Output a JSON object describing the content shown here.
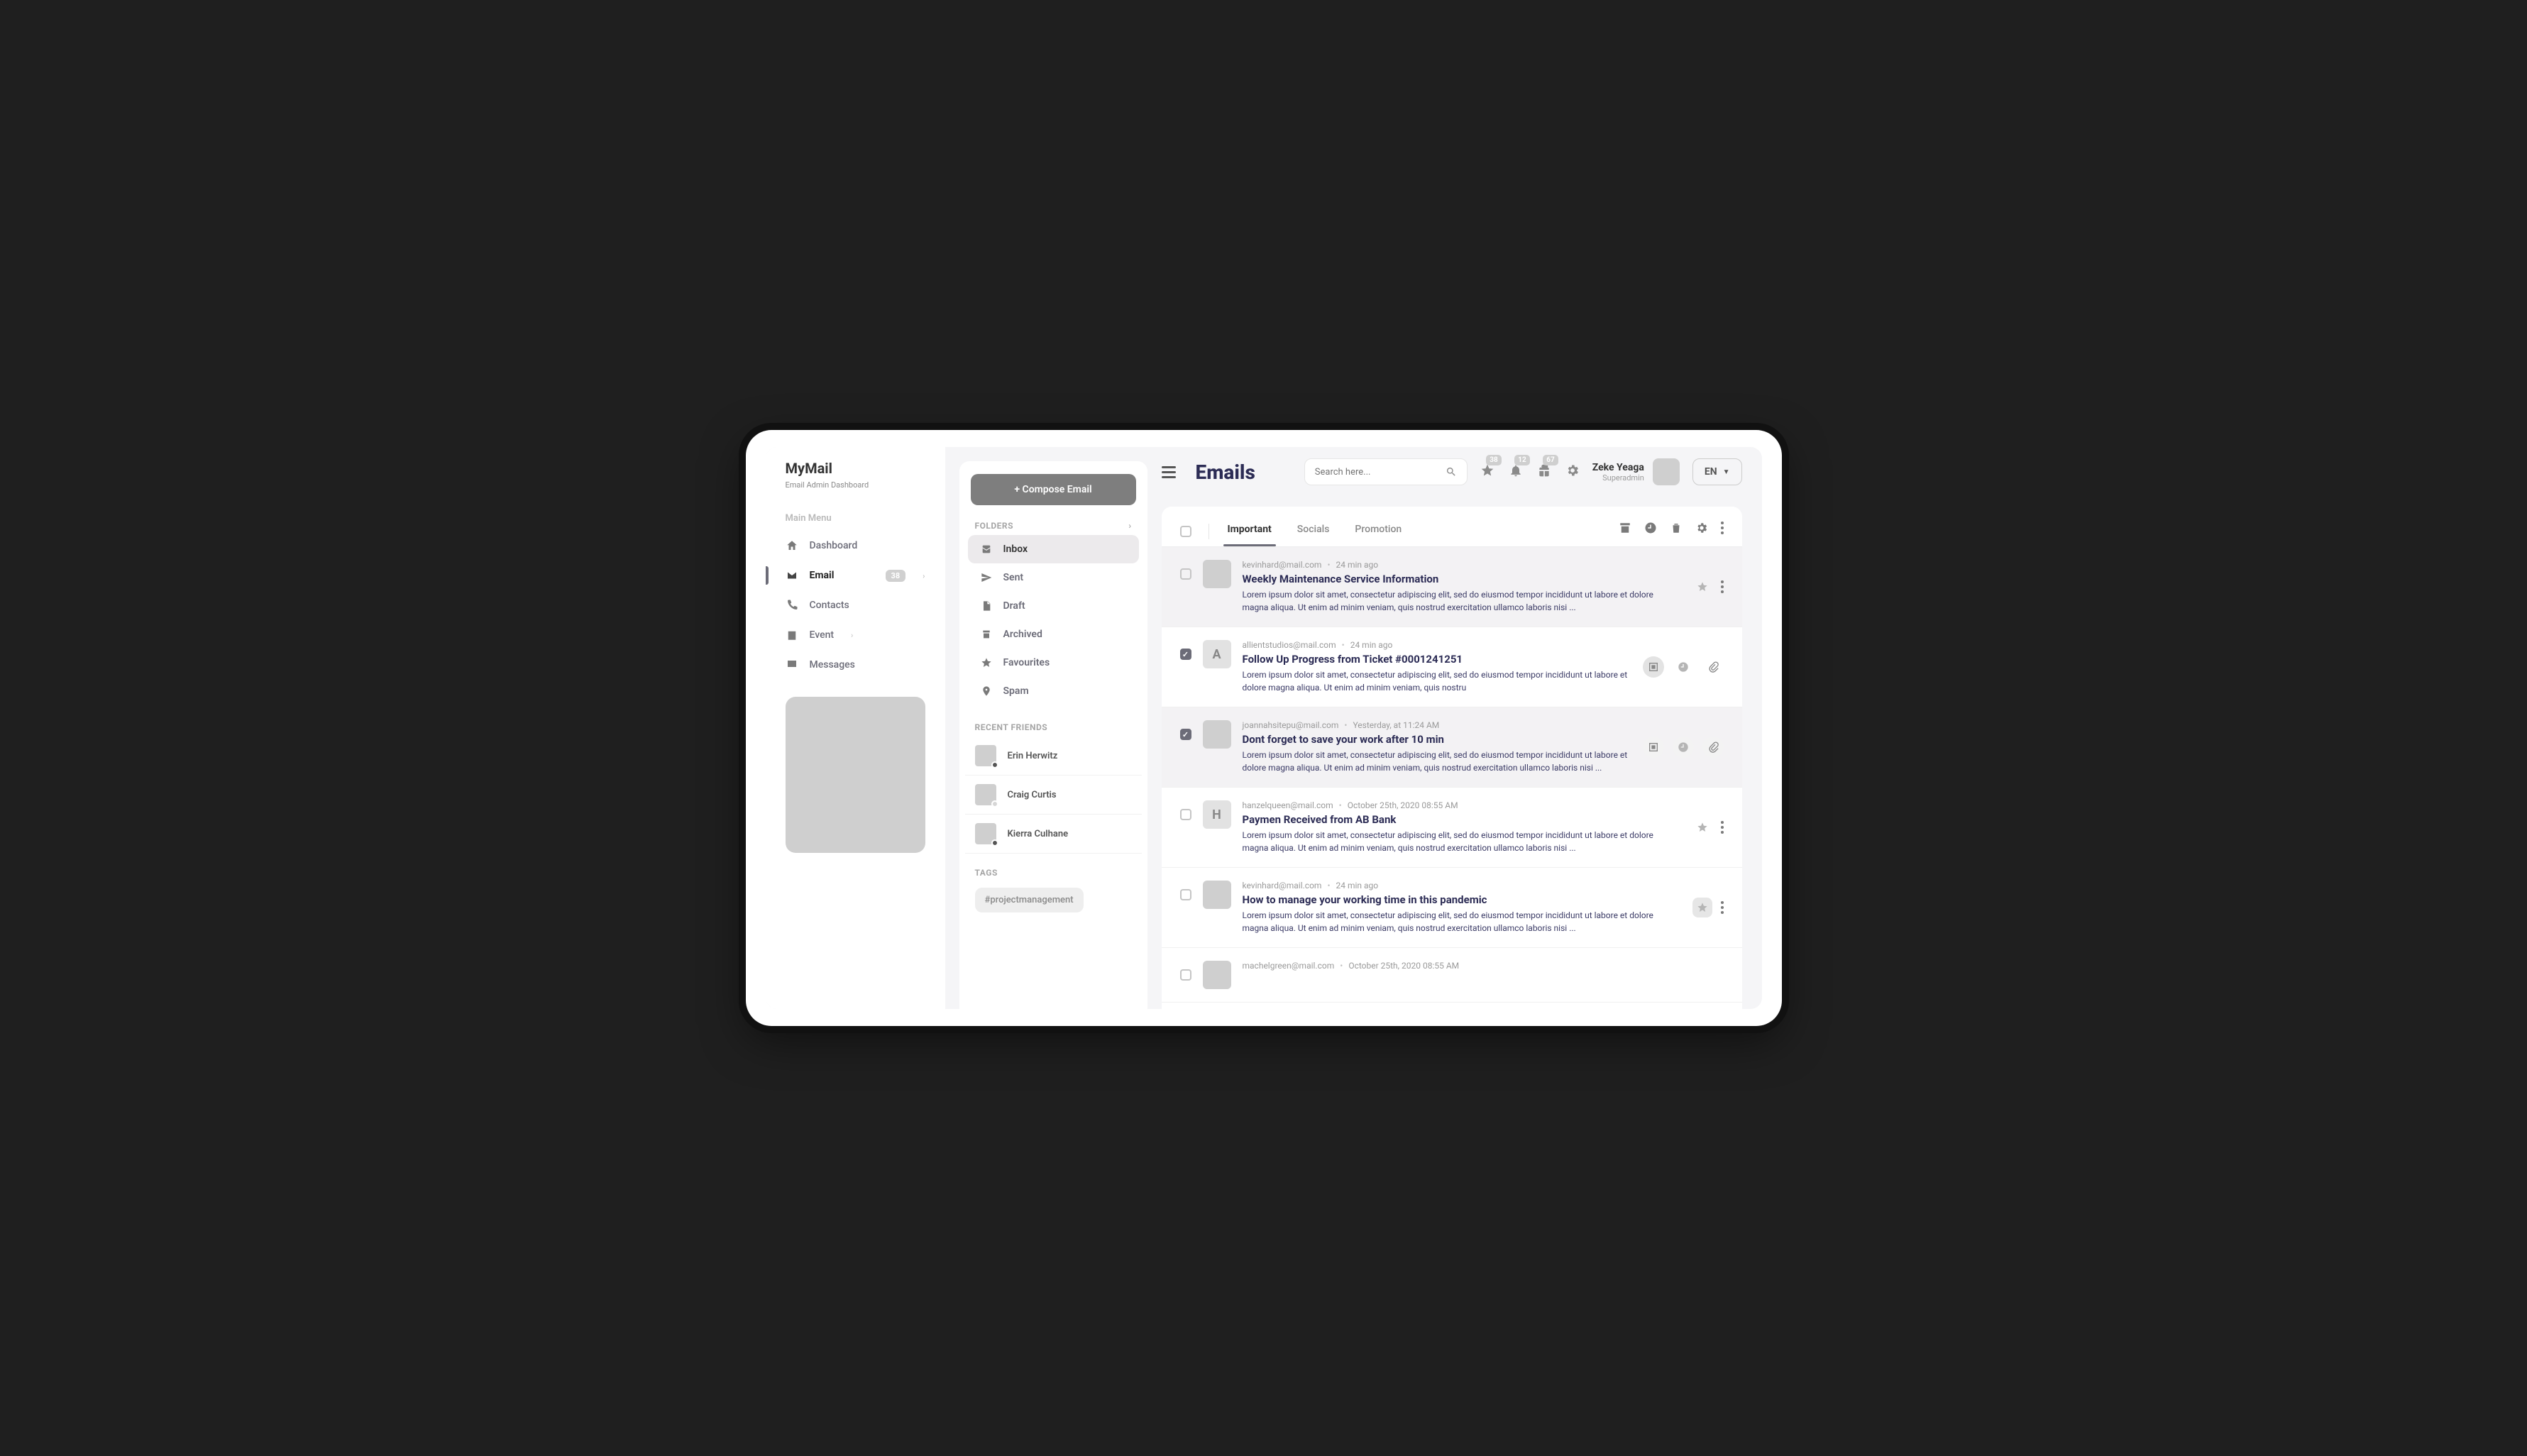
{
  "brand": {
    "name": "MyMail",
    "tagline": "Email Admin Dashboard"
  },
  "mainMenuLabel": "Main Menu",
  "nav": [
    {
      "label": "Dashboard",
      "active": false,
      "badge": null,
      "chevron": false
    },
    {
      "label": "Email",
      "active": true,
      "badge": "38",
      "chevron": true
    },
    {
      "label": "Contacts",
      "active": false,
      "badge": null,
      "chevron": false
    },
    {
      "label": "Event",
      "active": false,
      "badge": null,
      "chevron": true
    },
    {
      "label": "Messages",
      "active": false,
      "badge": null,
      "chevron": false
    }
  ],
  "header": {
    "pageTitle": "Emails",
    "searchPlaceholder": "Search here...",
    "iconBadges": {
      "star": "38",
      "bell": "12",
      "gift": "67"
    },
    "user": {
      "name": "Zeke Yeaga",
      "role": "Superadmin"
    },
    "language": "EN"
  },
  "composeLabel": "+ Compose Email",
  "foldersLabel": "FOLDERS",
  "folders": [
    {
      "label": "Inbox",
      "active": true
    },
    {
      "label": "Sent",
      "active": false
    },
    {
      "label": "Draft",
      "active": false
    },
    {
      "label": "Archived",
      "active": false
    },
    {
      "label": "Favourites",
      "active": false
    },
    {
      "label": "Spam",
      "active": false
    }
  ],
  "friendsLabel": "RECENT FRIENDS",
  "friends": [
    {
      "name": "Erin Herwitz",
      "dot": "#555"
    },
    {
      "name": "Craig Curtis",
      "dot": "#d6d6d6"
    },
    {
      "name": "Kierra Culhane",
      "dot": "#555"
    }
  ],
  "tagsLabel": "TAGS",
  "tags": [
    "#projectmanagement"
  ],
  "listTabs": [
    "Important",
    "Socials",
    "Promotion"
  ],
  "activeTab": 0,
  "emails": [
    {
      "from": "kevinhard@mail.com",
      "time": "24 min ago",
      "subject": "Weekly Maintenance Service Information",
      "preview": "Lorem ipsum dolor sit amet, consectetur adipiscing elit, sed do eiusmod tempor incididunt ut labore et dolore magna aliqua. Ut enim ad minim veniam, quis nostrud exercitation ullamco laboris nisi ...",
      "avatar": "",
      "selected": true,
      "checked": false,
      "actions": "star-dots",
      "starBoxed": false
    },
    {
      "from": "allientstudios@mail.com",
      "time": "24 min ago",
      "subject": "Follow Up Progress from Ticket #0001241251",
      "preview": "Lorem ipsum dolor sit amet, consectetur adipiscing elit, sed do eiusmod tempor incididunt ut labore et dolore magna aliqua. Ut enim ad minim veniam, quis nostru",
      "avatar": "A",
      "selected": false,
      "checked": true,
      "actions": "icons",
      "iconsActiveFirst": true
    },
    {
      "from": "joannahsitepu@mail.com",
      "time": "Yesterday, at 11:24 AM",
      "subject": "Dont forget to save your work after 10 min",
      "preview": "Lorem ipsum dolor sit amet, consectetur adipiscing elit, sed do eiusmod tempor incididunt ut labore et dolore magna aliqua. Ut enim ad minim veniam, quis nostrud exercitation ullamco laboris nisi ...",
      "avatar": "",
      "selected": true,
      "checked": true,
      "actions": "icons",
      "iconsActiveFirst": false
    },
    {
      "from": "hanzelqueen@mail.com",
      "time": "October 25th, 2020  08:55 AM",
      "subject": "Paymen Received from AB Bank",
      "preview": "Lorem ipsum dolor sit amet, consectetur adipiscing elit, sed do eiusmod tempor incididunt ut labore et dolore magna aliqua. Ut enim ad minim veniam, quis nostrud exercitation ullamco laboris nisi ...",
      "avatar": "H",
      "selected": false,
      "checked": false,
      "actions": "star-dots",
      "starBoxed": false
    },
    {
      "from": "kevinhard@mail.com",
      "time": "24 min ago",
      "subject": "How to manage your working time in this pandemic",
      "preview": "Lorem ipsum dolor sit amet, consectetur adipiscing elit, sed do eiusmod tempor incididunt ut labore et dolore magna aliqua. Ut enim ad minim veniam, quis nostrud exercitation ullamco laboris nisi ...",
      "avatar": "",
      "selected": false,
      "checked": false,
      "actions": "star-dots",
      "starBoxed": true
    },
    {
      "from": "machelgreen@mail.com",
      "time": "October 25th, 2020  08:55 AM",
      "subject": "",
      "preview": "",
      "avatar": "",
      "selected": false,
      "checked": false,
      "actions": "none"
    }
  ]
}
